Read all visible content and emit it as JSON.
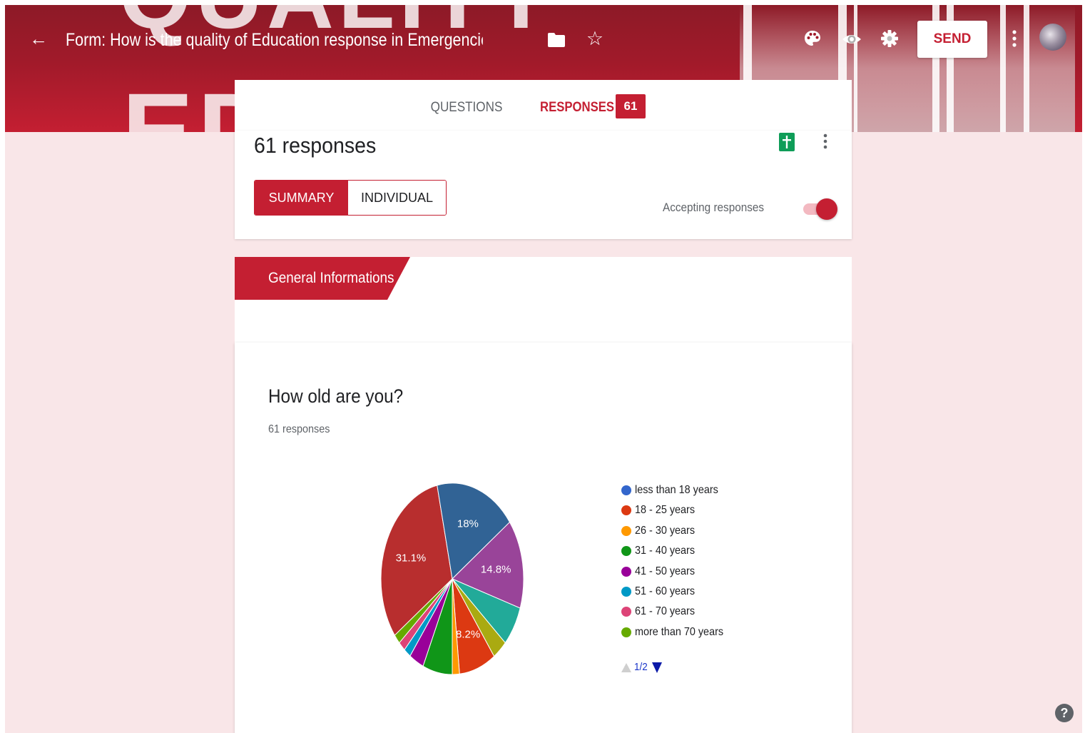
{
  "header": {
    "form_title": "Form: How is the quality of Education response in Emergencies be",
    "send_label": "SEND",
    "background_words": [
      "QUALITY",
      "EDUCATION"
    ]
  },
  "tabs": {
    "questions_label": "QUESTIONS",
    "responses_label": "RESPONSES",
    "responses_count": "61"
  },
  "summary": {
    "title": "61 responses",
    "summary_label": "SUMMARY",
    "individual_label": "INDIVIDUAL",
    "accepting_label": "Accepting responses",
    "accepting_on": true
  },
  "section": {
    "title": "General Informations"
  },
  "question": {
    "title": "How old are you?",
    "count": "61 responses"
  },
  "chart_data": {
    "type": "pie",
    "slices": [
      {
        "label": "31 - 40 years",
        "value": 6.6,
        "color": "#109618"
      },
      {
        "label": "41 - 50 years",
        "value": 3.3,
        "color": "#990099"
      },
      {
        "label": "51 - 60 years",
        "value": 1.6,
        "color": "#0099c6"
      },
      {
        "label": "61 - 70 years",
        "value": 1.6,
        "color": "#dd4477"
      },
      {
        "label": "more than 70 years",
        "value": 1.6,
        "color": "#66aa00"
      },
      {
        "label": "",
        "value": 31.1,
        "color": "#b82e2e",
        "display": "31.1%"
      },
      {
        "label": "",
        "value": 18.0,
        "color": "#316395",
        "display": "18%"
      },
      {
        "label": "",
        "value": 14.8,
        "color": "#994499",
        "display": "14.8%"
      },
      {
        "label": "",
        "value": 6.6,
        "color": "#22aa99"
      },
      {
        "label": "",
        "value": 3.3,
        "color": "#aaaa11"
      },
      {
        "label": "18 - 25 years",
        "value": 8.2,
        "color": "#dc3912",
        "display": "8.2%"
      },
      {
        "label": "26 - 30 years",
        "value": 1.6,
        "color": "#ff9900"
      },
      {
        "label": "less than 18 years",
        "value": 0,
        "color": "#3366cc"
      }
    ],
    "legend": [
      {
        "label": "less than 18 years",
        "color": "#3366cc"
      },
      {
        "label": "18 - 25 years",
        "color": "#dc3912"
      },
      {
        "label": "26 - 30 years",
        "color": "#ff9900"
      },
      {
        "label": "31 - 40 years",
        "color": "#109618"
      },
      {
        "label": "41 - 50 years",
        "color": "#990099"
      },
      {
        "label": "51 - 60 years",
        "color": "#0099c6"
      },
      {
        "label": "61 - 70 years",
        "color": "#dd4477"
      },
      {
        "label": "more than 70 years",
        "color": "#66aa00"
      }
    ],
    "legend_page": "1/2",
    "legend_placement": "right"
  },
  "icons": [
    "back-arrow-icon",
    "folder-icon",
    "star-icon",
    "palette-icon",
    "eye-icon",
    "gear-icon",
    "more-vert-icon",
    "sheets-icon",
    "help-icon"
  ],
  "colors": {
    "accent": "#c41f32",
    "page_background": "#f9e6e8"
  }
}
